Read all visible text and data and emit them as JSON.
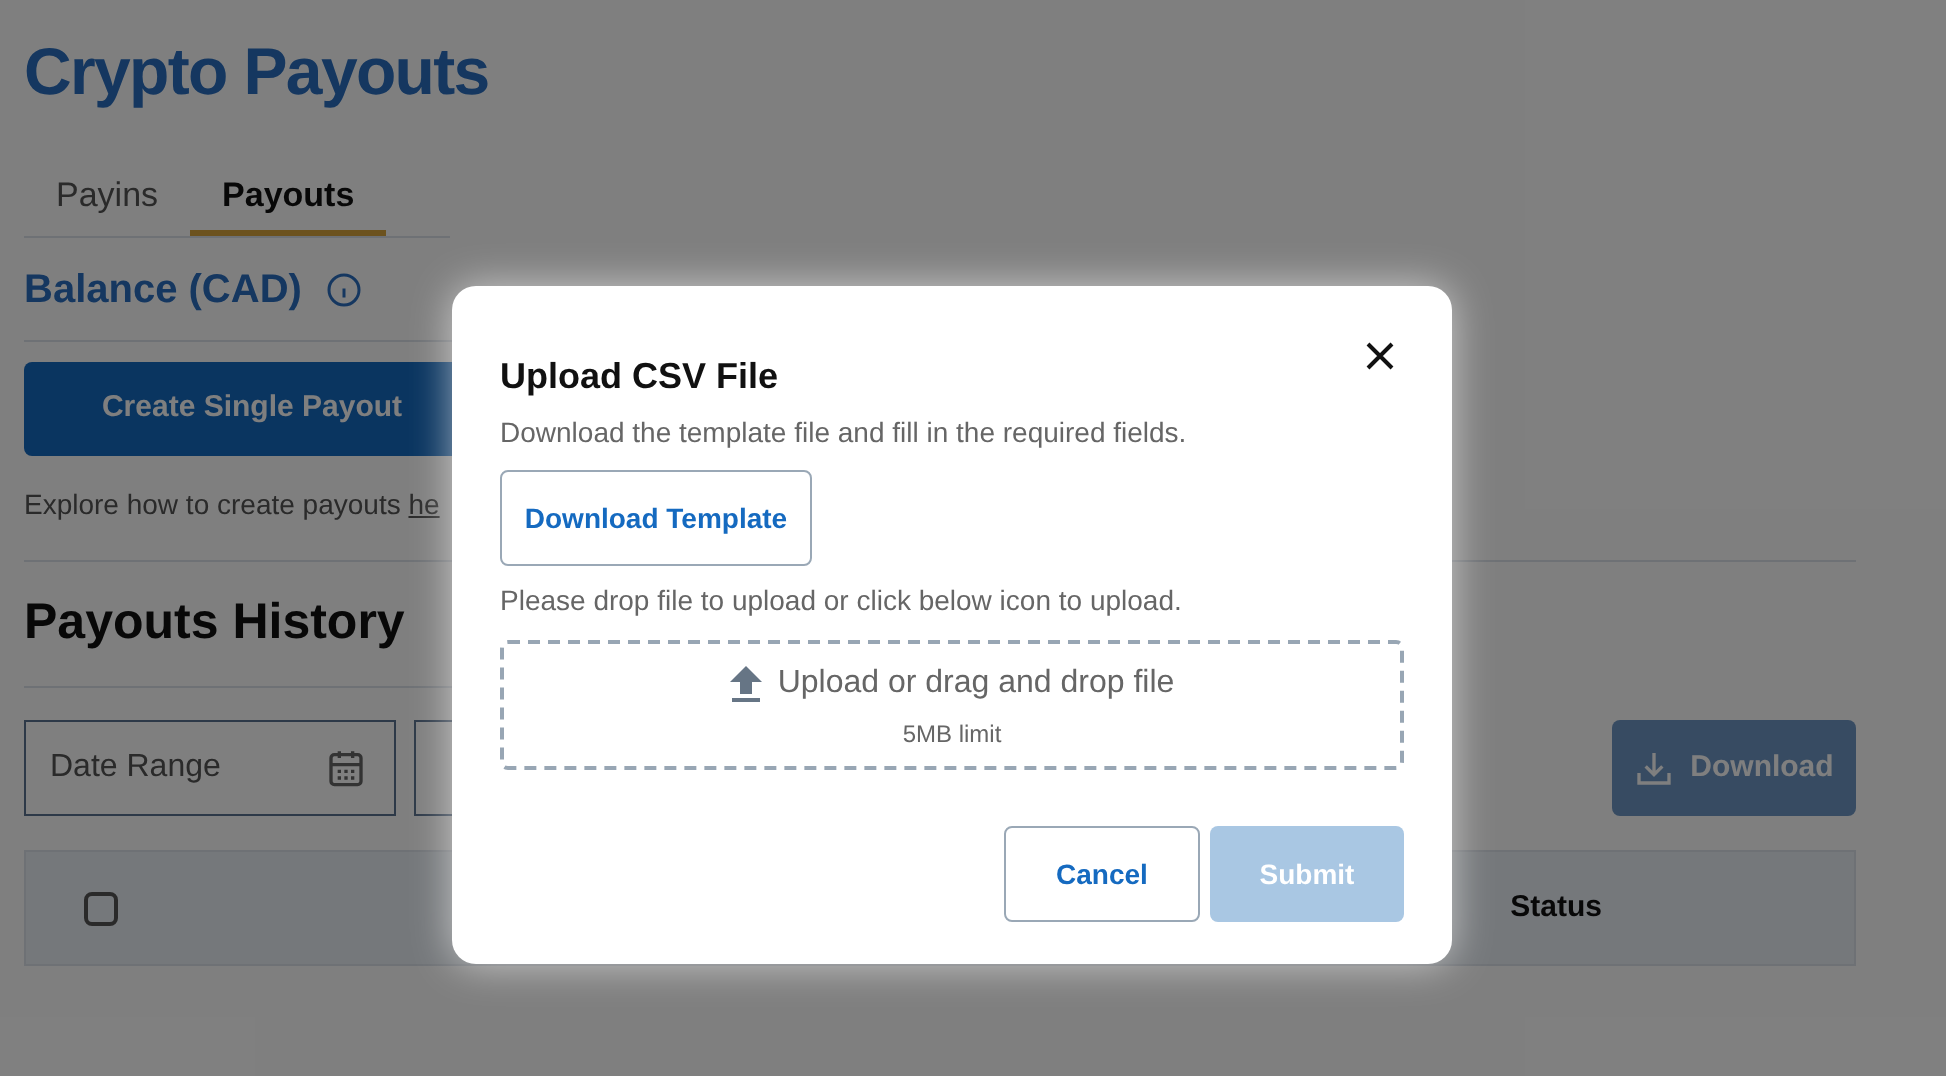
{
  "page_title": "Crypto Payouts",
  "tabs": [
    {
      "label": "Payins",
      "selected": false
    },
    {
      "label": "Payouts",
      "selected": true
    }
  ],
  "balance": {
    "title": "Balance (CAD)"
  },
  "create_button": "Create Single Payout",
  "explore": {
    "text": "Explore how to create payouts ",
    "link": "he"
  },
  "history": {
    "title": "Payouts History",
    "filters": [
      {
        "placeholder": "Date Range",
        "kind": "date"
      },
      {
        "kind": "text"
      }
    ],
    "download_button": {
      "label": "Download",
      "disabled": true
    },
    "table": {
      "select_all_checked": false,
      "columns": [
        "Status"
      ]
    }
  },
  "modal": {
    "title": "Upload CSV File",
    "description": "Download the template file and fill in the required fields.",
    "template_button": "Download Template",
    "drop_hint": "Please drop file to upload or click below icon to upload.",
    "dropzone": {
      "label": "Upload or drag and drop file",
      "limit": "5MB limit"
    },
    "cancel_button": "Cancel",
    "submit_button": {
      "label": "Submit",
      "disabled": true
    }
  }
}
